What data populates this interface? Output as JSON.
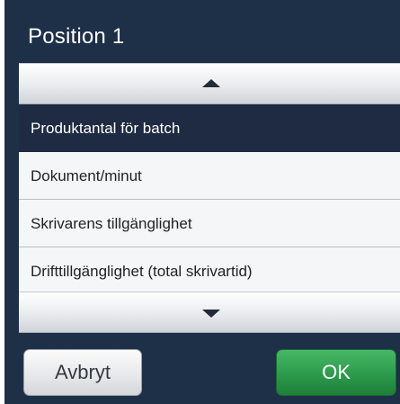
{
  "header": {
    "title": "Position 1"
  },
  "list": {
    "scroll_up_icon": "triangle-up-icon",
    "scroll_down_icon": "triangle-down-icon",
    "items": [
      {
        "label": "Produktantal för batch",
        "selected": true
      },
      {
        "label": "Dokument/minut",
        "selected": false
      },
      {
        "label": "Skrivarens tillgänglighet",
        "selected": false
      },
      {
        "label": "Drifttillgänglighet (total skrivartid)",
        "selected": false
      }
    ]
  },
  "footer": {
    "cancel_label": "Avbryt",
    "ok_label": "OK"
  },
  "colors": {
    "background": "#1e2f48",
    "selected_row": "#1f2b43",
    "ok_button": "#2c9a4b"
  }
}
